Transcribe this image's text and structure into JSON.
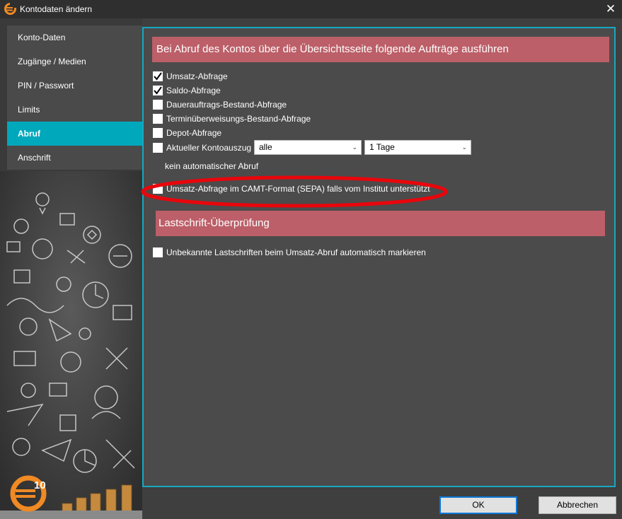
{
  "window": {
    "title": "Kontodaten ändern",
    "close_symbol": "✕",
    "icon": "euro-logo-icon",
    "brand_color": "#f08a24"
  },
  "sidebar": {
    "items": [
      {
        "label": "Konto-Daten"
      },
      {
        "label": "Zugänge / Medien"
      },
      {
        "label": "PIN / Passwort"
      },
      {
        "label": "Limits"
      },
      {
        "label": "Abruf",
        "active": true
      },
      {
        "label": "Anschrift"
      }
    ],
    "active_color": "#00a8bc",
    "logo_text": "10"
  },
  "abruf": {
    "header": "Bei Abruf des Kontos über die Übersichtsseite folgende Aufträge ausführen",
    "options": [
      {
        "label": "Umsatz-Abfrage",
        "checked": true
      },
      {
        "label": "Saldo-Abfrage",
        "checked": true
      },
      {
        "label": "Dauerauftrags-Bestand-Abfrage",
        "checked": false
      },
      {
        "label": "Terminüberweisungs-Bestand-Abfrage",
        "checked": false
      },
      {
        "label": "Depot-Abfrage",
        "checked": false
      },
      {
        "label": "Aktueller Kontoauszug",
        "checked": false
      }
    ],
    "kontoauszug_select": "alle",
    "tage_select": "1 Tage",
    "hint": "kein automatischer Abruf",
    "camt": {
      "label": "Umsatz-Abfrage im CAMT-Format (SEPA) falls vom Institut unterstützt",
      "checked": false
    },
    "header_color": "#bc5f68",
    "highlight_color": "#e8060c"
  },
  "lastschrift": {
    "header": "Lastschrift-Überprüfung",
    "option": {
      "label": "Unbekannte Lastschriften beim Umsatz-Abruf automatisch markieren",
      "checked": false
    }
  },
  "buttons": {
    "ok": "OK",
    "cancel": "Abbrechen"
  }
}
